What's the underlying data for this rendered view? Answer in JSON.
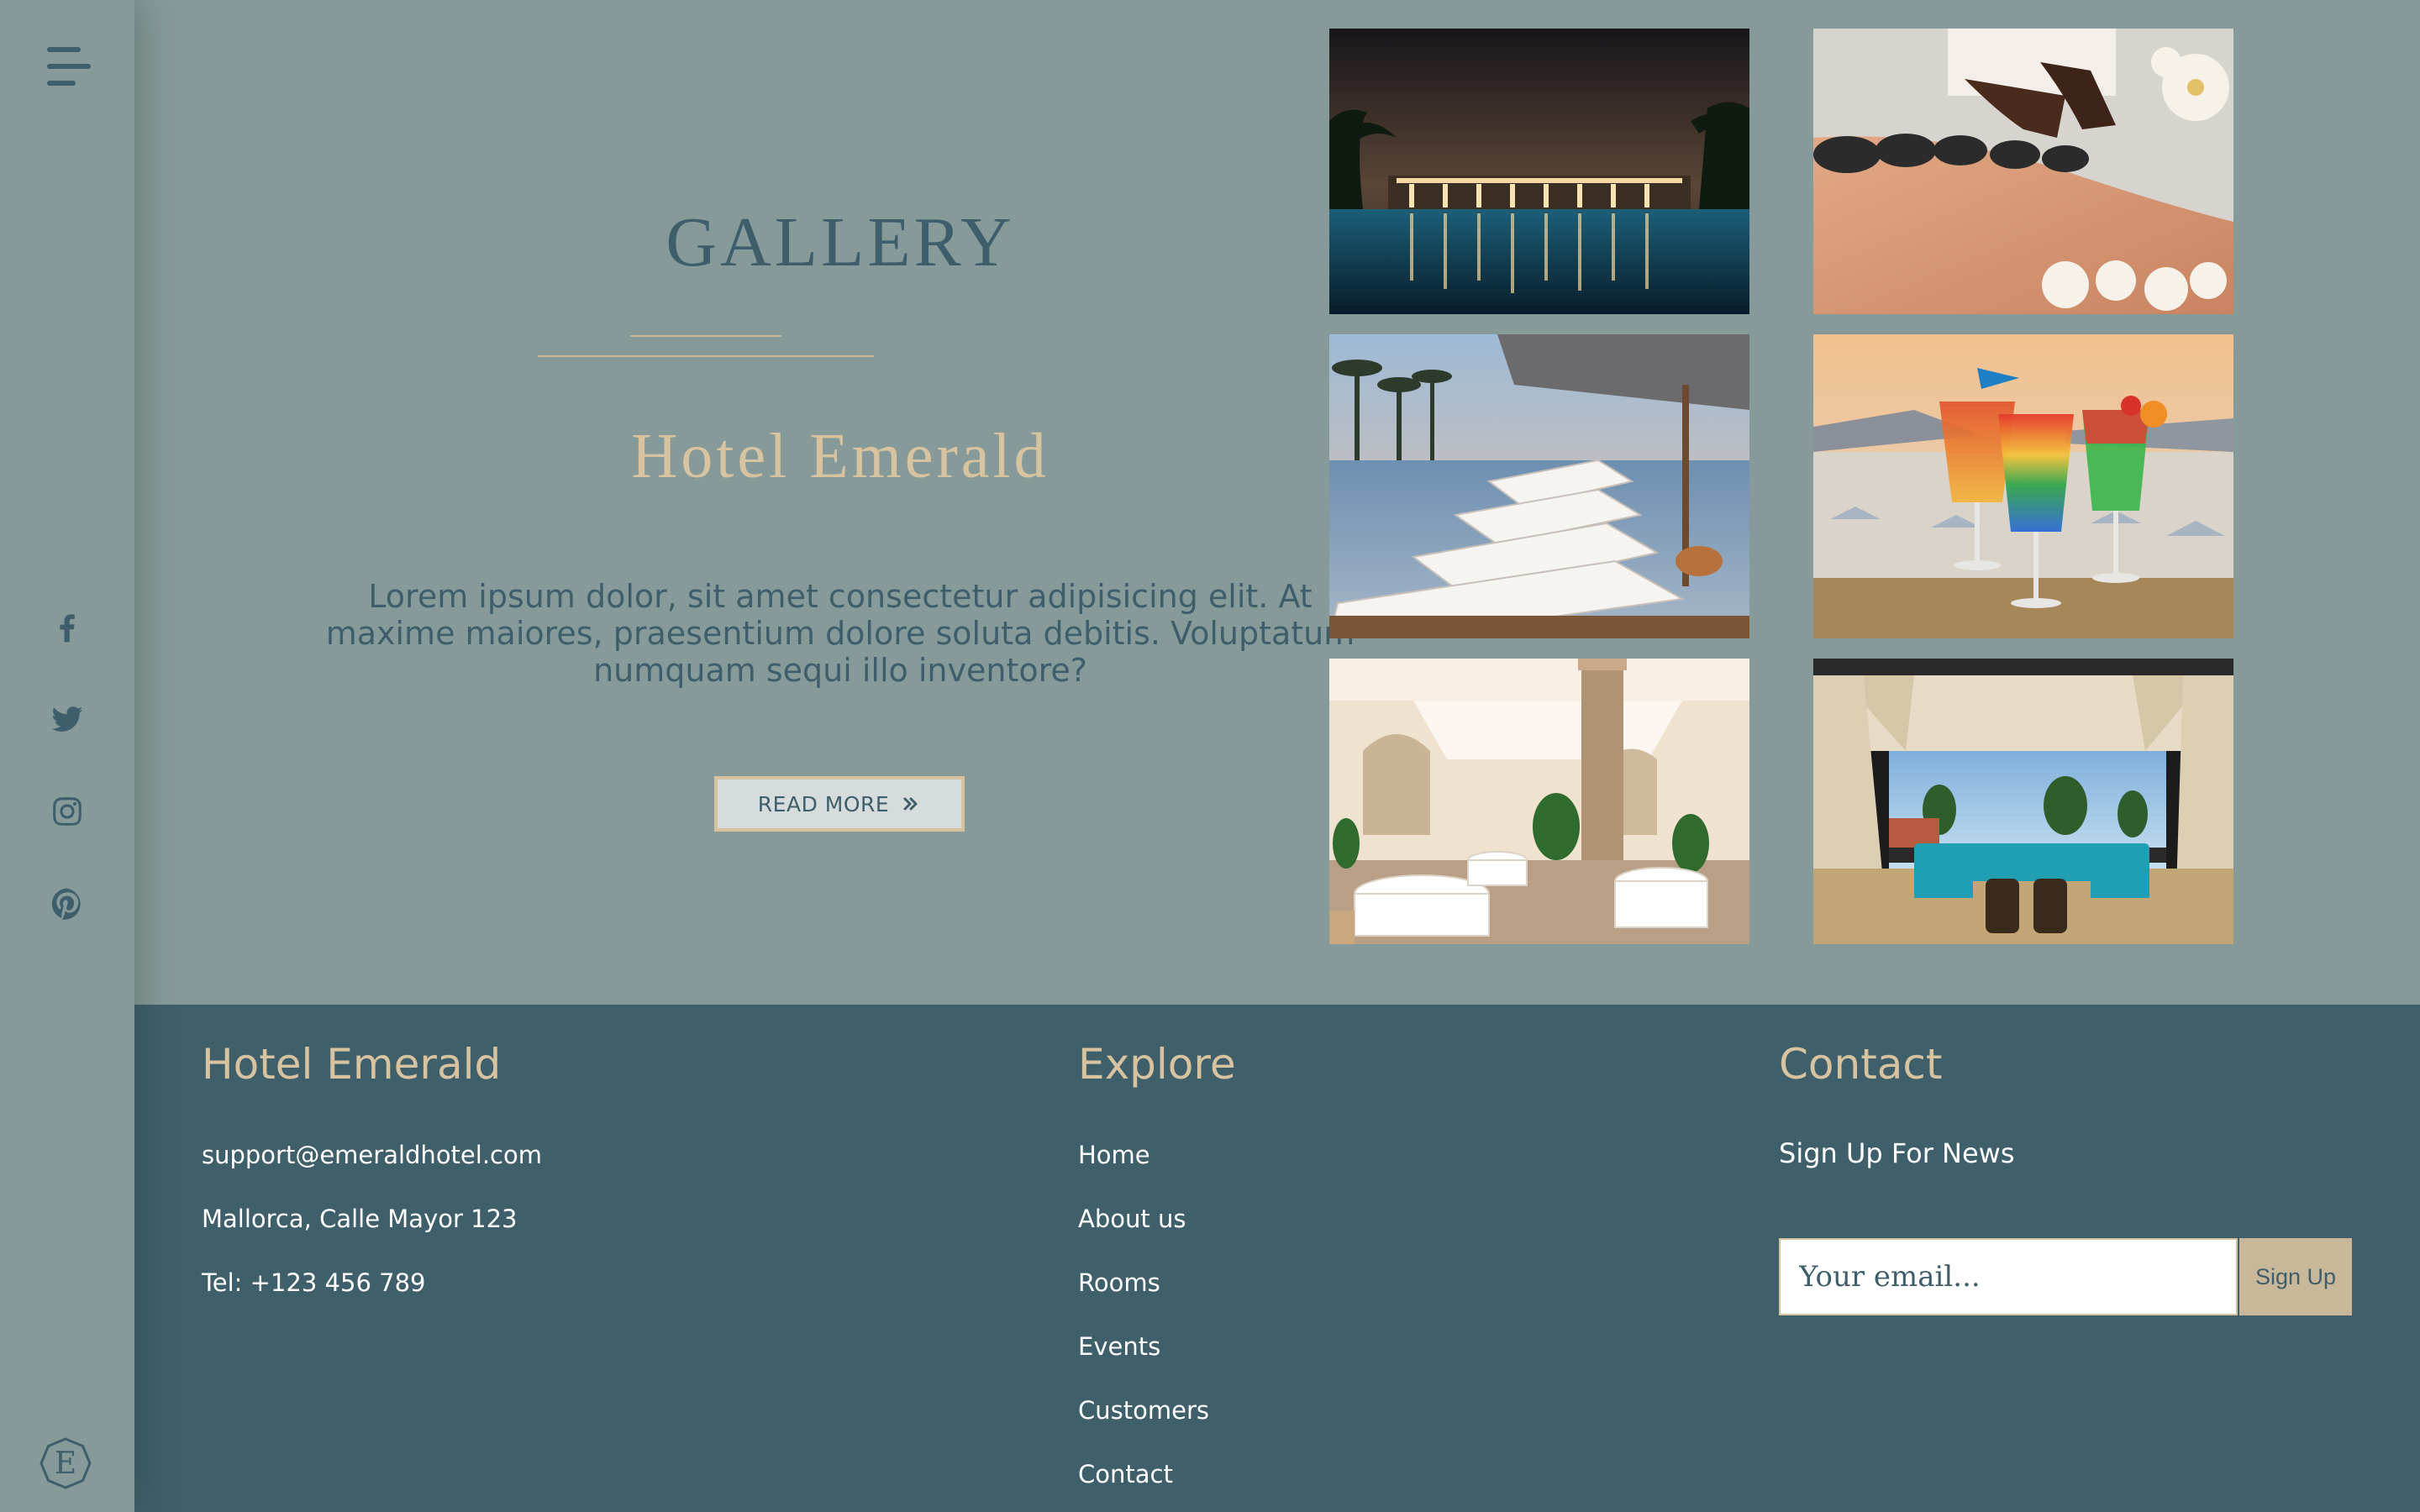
{
  "sidebar": {
    "menu_icon": "hamburger-menu-icon",
    "social": [
      {
        "name": "facebook-icon"
      },
      {
        "name": "twitter-icon"
      },
      {
        "name": "instagram-icon"
      },
      {
        "name": "pinterest-icon"
      }
    ],
    "logo_letter": "E"
  },
  "gallery": {
    "title": "GALLERY",
    "subtitle": "Hotel Emerald",
    "description": "Lorem ipsum dolor, sit amet consectetur adipisicing elit. At maxime maiores, praesentium dolore soluta debitis. Voluptatum numquam sequi illo inventore?",
    "read_more_label": "READ MORE",
    "read_more_icon": "double-chevron-right-icon",
    "photos": [
      {
        "name": "pool-at-night-photo"
      },
      {
        "name": "hot-stone-massage-photo"
      },
      {
        "name": "infinity-pool-loungers-photo"
      },
      {
        "name": "cocktails-photo"
      },
      {
        "name": "restaurant-dining-room-photo"
      },
      {
        "name": "terrace-lounge-photo"
      }
    ]
  },
  "footer": {
    "brand": {
      "title": "Hotel Emerald",
      "email": "support@emeraldhotel.com",
      "address": "Mallorca, Calle Mayor 123",
      "phone": "Tel: +123 456 789"
    },
    "explore": {
      "title": "Explore",
      "links": [
        "Home",
        "About us",
        "Rooms",
        "Events",
        "Customers",
        "Contact"
      ]
    },
    "contact": {
      "title": "Contact",
      "newsletter_label": "Sign Up For News",
      "email_placeholder": "Your email...",
      "signup_label": "Sign Up"
    }
  },
  "colors": {
    "background": "#869b99",
    "primary": "#3f5e6b",
    "accent": "#d7c3a0",
    "footer": "#3f5f6b"
  }
}
